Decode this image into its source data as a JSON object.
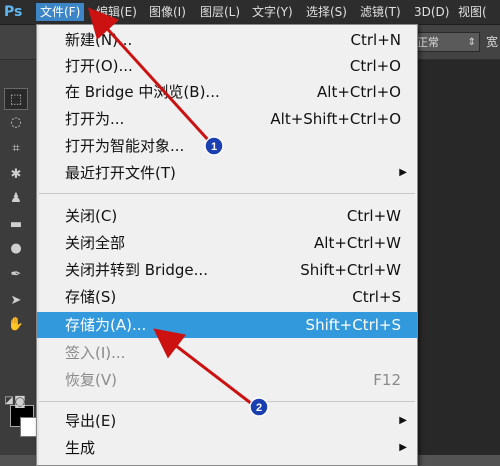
{
  "app": {
    "logo": "Ps"
  },
  "menubar": {
    "items": [
      "文件(F)",
      "编辑(E)",
      "图像(I)",
      "图层(L)",
      "文字(Y)",
      "选择(S)",
      "滤镜(T)",
      "3D(D)",
      "视图("
    ]
  },
  "options_bar": {
    "blend_mode": "正常",
    "trailing_label": "宽"
  },
  "file_menu": {
    "items": [
      {
        "label": "新建(N)...",
        "shortcut": "Ctrl+N"
      },
      {
        "label": "打开(O)...",
        "shortcut": "Ctrl+O"
      },
      {
        "label": "在 Bridge 中浏览(B)...",
        "shortcut": "Alt+Ctrl+O"
      },
      {
        "label": "打开为...",
        "shortcut": "Alt+Shift+Ctrl+O"
      },
      {
        "label": "打开为智能对象...",
        "shortcut": ""
      },
      {
        "label": "最近打开文件(T)",
        "shortcut": ""
      },
      {
        "label": "关闭(C)",
        "shortcut": "Ctrl+W"
      },
      {
        "label": "关闭全部",
        "shortcut": "Alt+Ctrl+W"
      },
      {
        "label": "关闭并转到 Bridge...",
        "shortcut": "Shift+Ctrl+W"
      },
      {
        "label": "存储(S)",
        "shortcut": "Ctrl+S"
      },
      {
        "label": "存储为(A)...",
        "shortcut": "Shift+Ctrl+S"
      },
      {
        "label": "签入(I)...",
        "shortcut": ""
      },
      {
        "label": "恢复(V)",
        "shortcut": "F12"
      },
      {
        "label": "导出(E)",
        "shortcut": ""
      },
      {
        "label": "生成",
        "shortcut": ""
      }
    ]
  },
  "annotations": {
    "step1": "1",
    "step2": "2"
  },
  "colors": {
    "highlight": "#3399dd",
    "arrow": "#cc1111",
    "badge": "#1a3fb0"
  }
}
